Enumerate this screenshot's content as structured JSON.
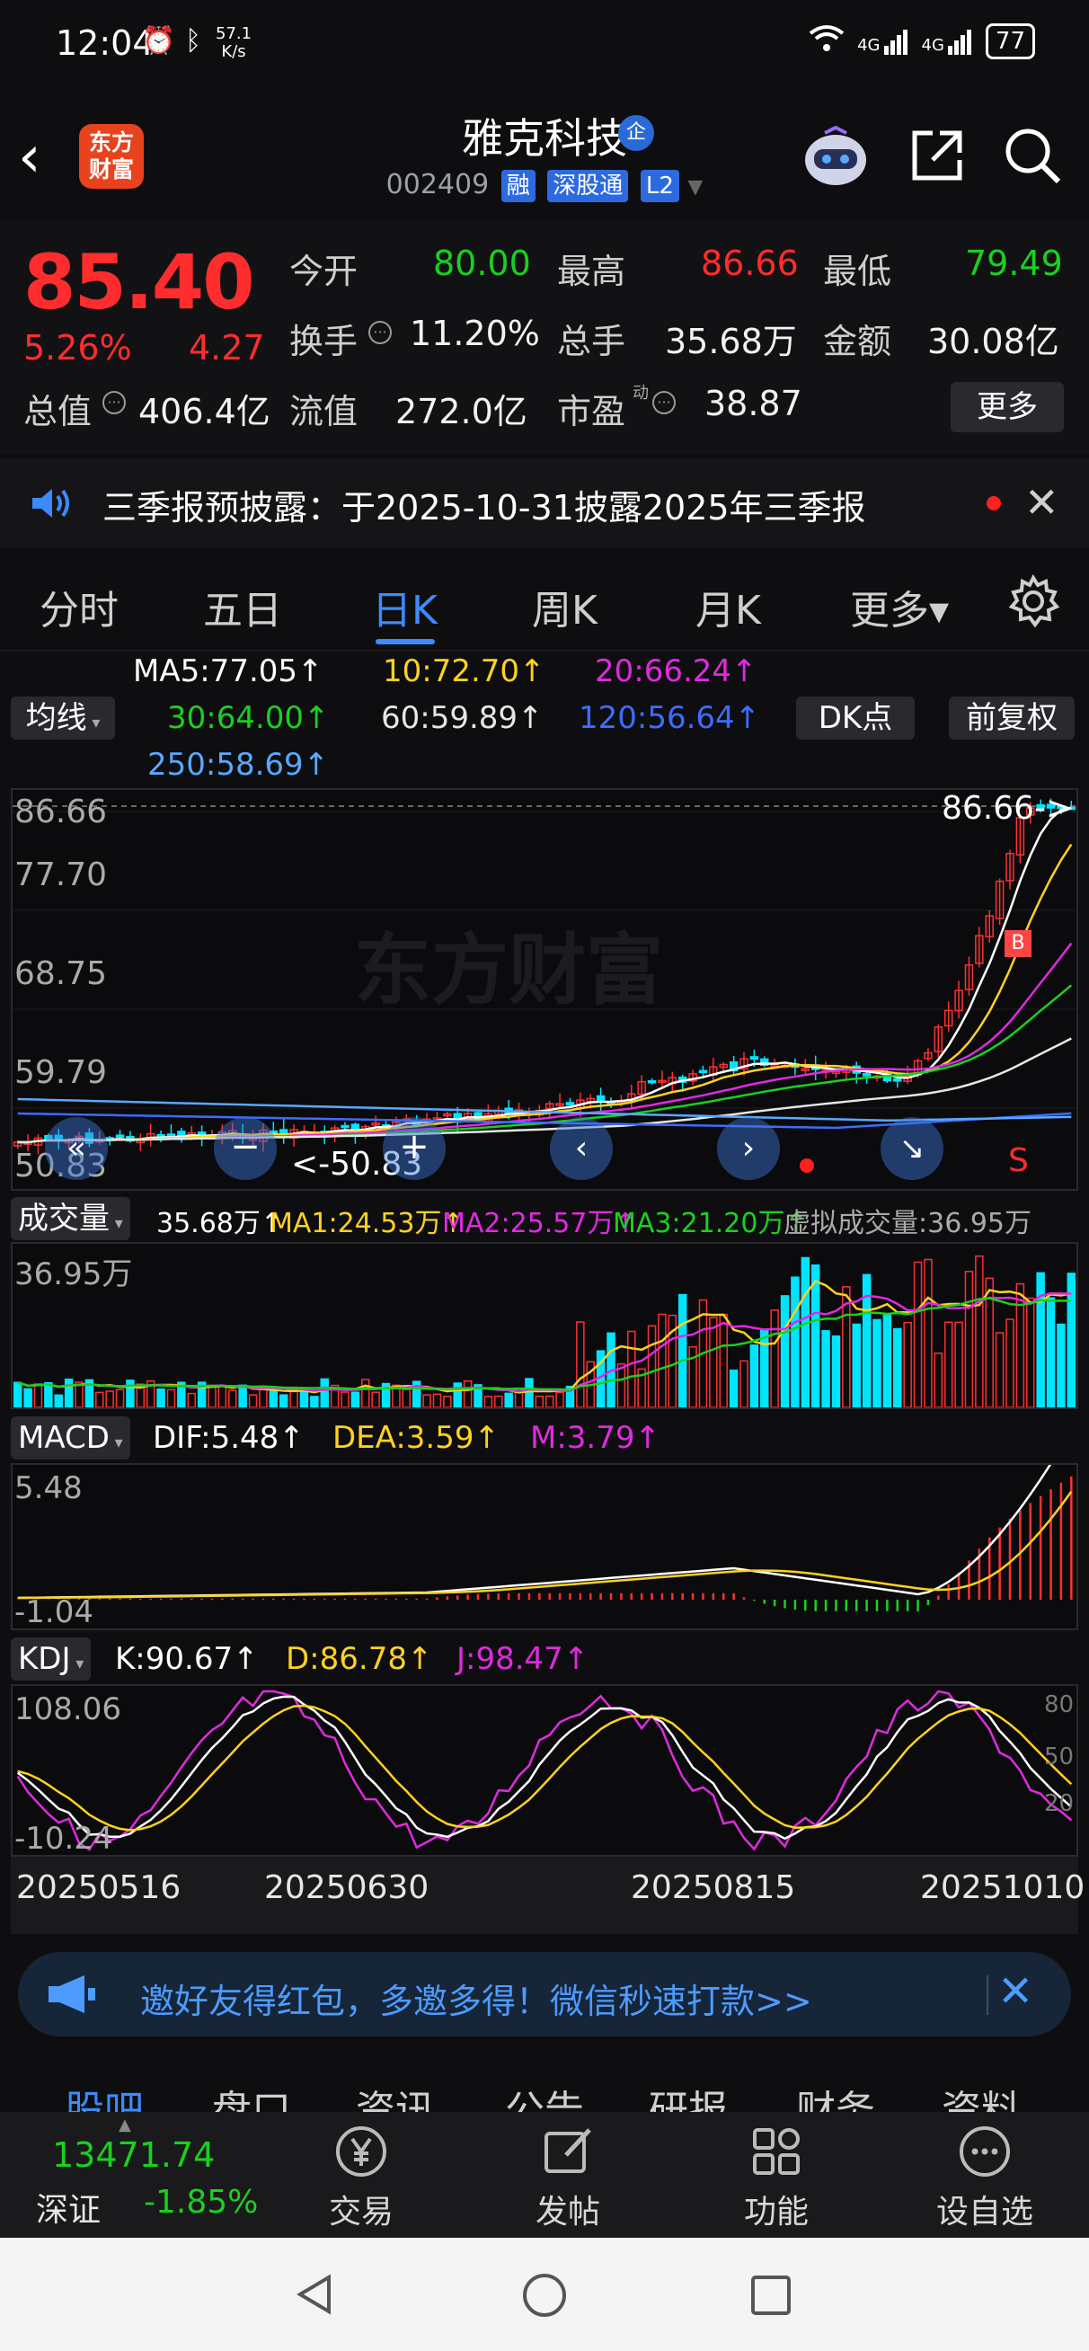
{
  "status": {
    "time": "12:04",
    "net_speed_value": "57.1",
    "net_speed_unit": "K/s",
    "signal_1": "4G",
    "signal_2": "4G",
    "battery": "77"
  },
  "header": {
    "logo_line1": "东方",
    "logo_line2": "财富",
    "stock_name": "雅克科技",
    "qi_badge": "企",
    "code": "002409",
    "tag_rong": "融",
    "tag_sgt": "深股通",
    "tag_l2": "L2"
  },
  "quote": {
    "price": "85.40",
    "change_pct": "5.26%",
    "change_amt": "4.27",
    "open_label": "今开",
    "open": "80.00",
    "high_label": "最高",
    "high": "86.66",
    "low_label": "最低",
    "low": "79.49",
    "turnover_label": "换手",
    "turnover": "11.20%",
    "volume_label": "总手",
    "volume": "35.68万",
    "amount_label": "金额",
    "amount": "30.08亿",
    "mktcap_label": "总值",
    "mktcap": "406.4亿",
    "float_label": "流值",
    "float_cap": "272.0亿",
    "pe_label": "市盈",
    "pe_sup": "动",
    "pe": "38.87",
    "more": "更多"
  },
  "notice": {
    "text": "三季报预披露：于2025-10-31披露2025年三季报"
  },
  "period_tabs": [
    "分时",
    "五日",
    "日K",
    "周K",
    "月K",
    "更多▾"
  ],
  "ma": {
    "selector": "均线",
    "ma5": "MA5:77.05↑",
    "ma10": "10:72.70↑",
    "ma20": "20:66.24↑",
    "ma30": "30:64.00↑",
    "ma60": "60:59.89↑",
    "ma120": "120:56.64↑",
    "ma250": "250:58.69↑",
    "dk_btn": "DK点",
    "adjust_btn": "前复权",
    "colors": {
      "ma5": "#ffffff",
      "ma10": "#ffd21e",
      "ma20": "#e02ae0",
      "ma30": "#19d11e",
      "ma60": "#e6e6e6",
      "ma120": "#3d6cff",
      "ma250": "#5aa8ff"
    }
  },
  "kline": {
    "y_labels": [
      "86.66",
      "77.70",
      "68.75",
      "59.79",
      "50.83"
    ],
    "max_marker": "86.66->",
    "min_marker": "<-50.83",
    "watermark": "东方财富",
    "signal_s": "S",
    "signal_b": "B"
  },
  "volume": {
    "selector": "成交量",
    "vol": "35.68万↑",
    "ma1": "MA1:24.53万↑",
    "ma2": "MA2:25.57万↑",
    "ma3": "MA3:21.20万↑",
    "virtual": "虚拟成交量:36.95万",
    "y_top": "36.95万"
  },
  "macd": {
    "selector": "MACD",
    "dif": "DIF:5.48↑",
    "dea": "DEA:3.59↑",
    "m": "M:3.79↑",
    "y_top": "5.48",
    "y_bottom": "-1.04"
  },
  "kdj": {
    "selector": "KDJ",
    "k": "K:90.67↑",
    "d": "D:86.78↑",
    "j": "J:98.47↑",
    "y_top": "108.06",
    "y_bottom": "-10.24",
    "r80": "80",
    "r50": "50",
    "r20": "20"
  },
  "dates": [
    "20250516",
    "20250630",
    "20250815",
    "20251010"
  ],
  "promo": {
    "text": "邀好友得红包，多邀多得！微信秒速打款>>"
  },
  "content_tabs": [
    "股吧",
    "盘口",
    "资讯",
    "公告",
    "研报",
    "财务",
    "资料"
  ],
  "bottom_nav": {
    "index_value": "13471.74",
    "index_name": "深证",
    "index_change": "-1.85%",
    "items": [
      "交易",
      "发帖",
      "功能",
      "设自选"
    ]
  }
}
